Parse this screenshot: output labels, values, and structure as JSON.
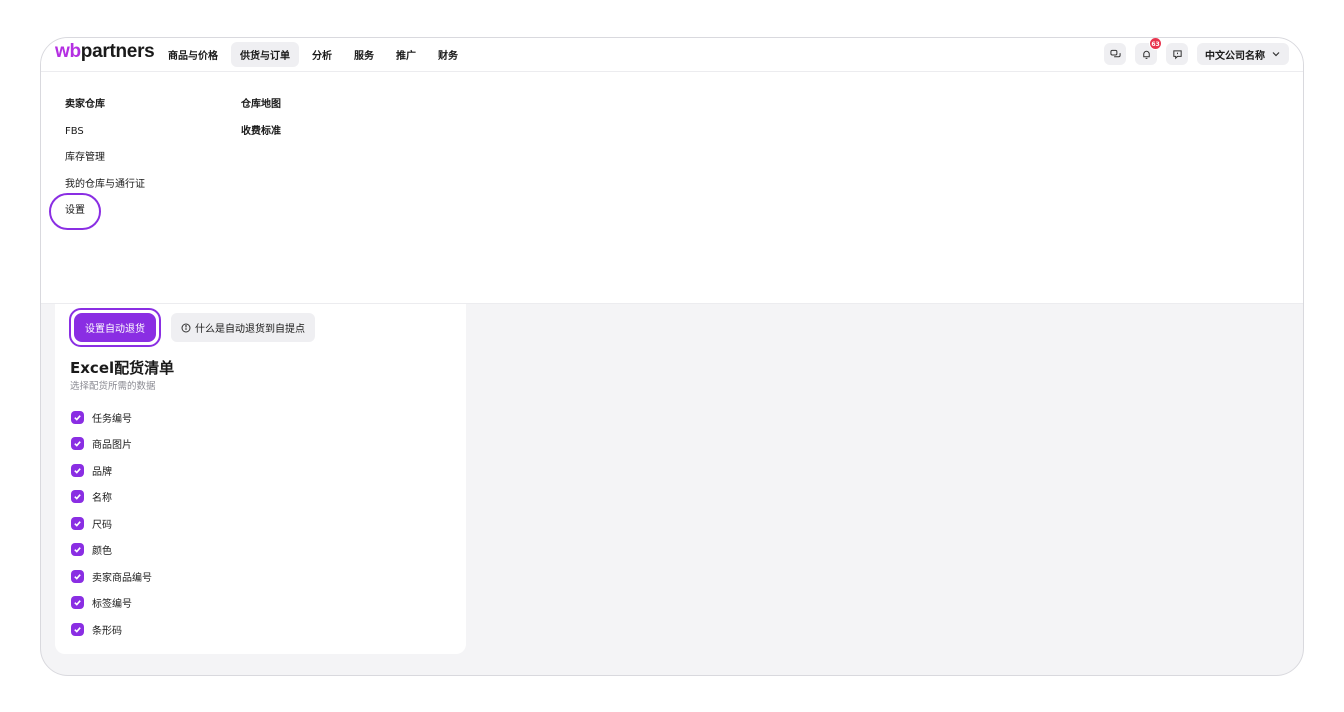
{
  "header": {
    "logo_wb": "wb",
    "logo_rest": "partners",
    "nav": [
      {
        "label": "商品与价格",
        "active": false
      },
      {
        "label": "供货与订单",
        "active": true
      },
      {
        "label": "分析",
        "active": false
      },
      {
        "label": "服务",
        "active": false
      },
      {
        "label": "推广",
        "active": false
      },
      {
        "label": "财务",
        "active": false
      }
    ],
    "notifications_badge": "63",
    "company_name": "中文公司名称"
  },
  "dropdown": {
    "column1": [
      "卖家仓库",
      "FBS",
      "库存管理",
      "我的仓库与通行证",
      "设置"
    ],
    "column2": [
      "仓库地图",
      "收费标准"
    ]
  },
  "content": {
    "primary_button": "设置自动退货",
    "info_button": "什么是自动退货到自提点",
    "section_title": "Excel配货清单",
    "section_subtitle": "选择配货所需的数据",
    "checklist": [
      "任务编号",
      "商品图片",
      "品牌",
      "名称",
      "尺码",
      "颜色",
      "卖家商品编号",
      "标签编号",
      "条形码"
    ]
  },
  "colors": {
    "accent": "#8a2ee3",
    "brand": "#b42fe2",
    "badge": "#e8364f"
  }
}
